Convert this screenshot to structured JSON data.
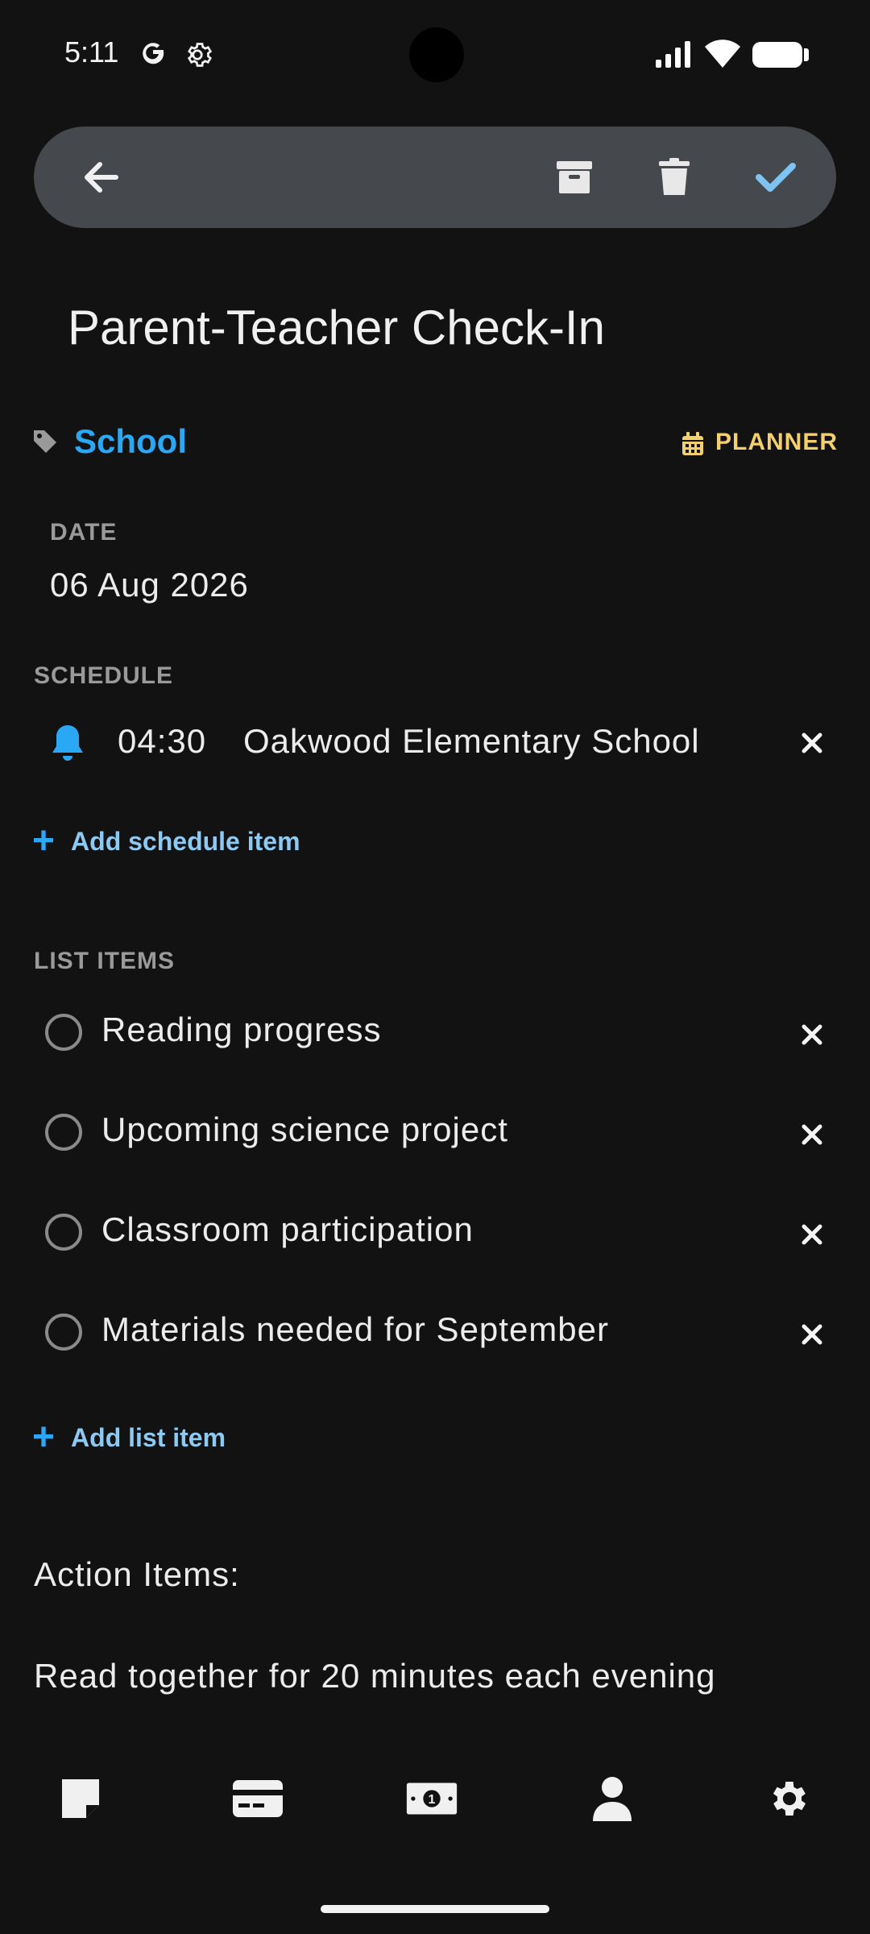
{
  "status_bar": {
    "time": "5:11"
  },
  "toolbar": {
    "back": "back-arrow-icon",
    "archive": "archive-icon",
    "delete": "trash-icon",
    "confirm": "check-icon",
    "confirm_color": "#7fc3f3"
  },
  "note": {
    "title": "Parent-Teacher Check-In",
    "category": "School",
    "type_label": "PLANNER",
    "accent_color": "#2aa8f5",
    "planner_color": "#f3cf6d"
  },
  "date": {
    "label": "DATE",
    "value": "06 Aug 2026"
  },
  "schedule": {
    "label": "SCHEDULE",
    "items": [
      {
        "time": "04:30",
        "place": "Oakwood Elementary School"
      }
    ],
    "add_label": "Add schedule item"
  },
  "list": {
    "label": "LIST ITEMS",
    "items": [
      {
        "text": "Reading progress",
        "checked": false
      },
      {
        "text": "Upcoming science project",
        "checked": false
      },
      {
        "text": "Classroom participation",
        "checked": false
      },
      {
        "text": "Materials needed for September",
        "checked": false
      }
    ],
    "add_label": "Add list item"
  },
  "notes": {
    "line1": "Action Items:",
    "line2": "Read together for 20 minutes each evening"
  },
  "bottom_nav": [
    "note-icon",
    "card-icon",
    "money-icon",
    "person-icon",
    "settings-icon"
  ]
}
